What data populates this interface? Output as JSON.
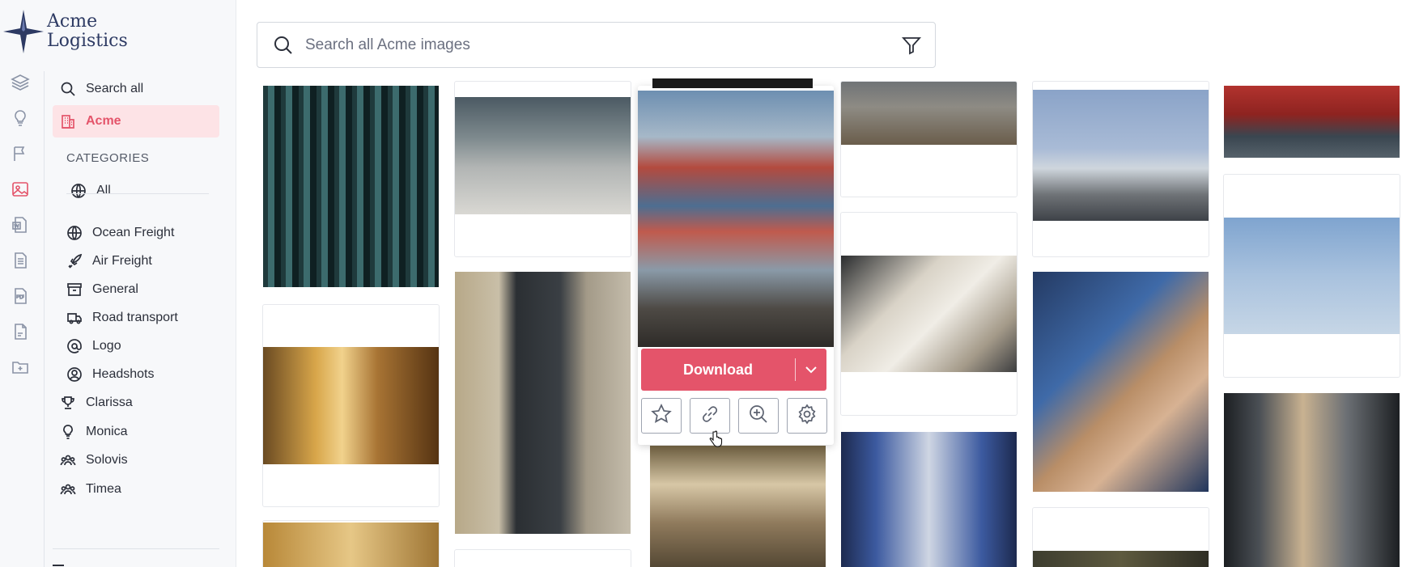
{
  "brand": {
    "line1": "Acme",
    "line2": "Logistics",
    "color": "#2d3a63"
  },
  "rail": [
    {
      "icon": "layers-icon"
    },
    {
      "icon": "bulb-icon"
    },
    {
      "icon": "flag-icon"
    },
    {
      "icon": "image-icon",
      "active": true
    },
    {
      "icon": "doc-word-icon"
    },
    {
      "icon": "doc-lines-icon"
    },
    {
      "icon": "pdf-icon"
    },
    {
      "icon": "file-icon"
    },
    {
      "icon": "folder-plus-icon"
    }
  ],
  "nav": {
    "search_all": "Search all",
    "acme": "Acme",
    "categories_heading": "CATEGORIES",
    "all": "All",
    "ocean_freight": "Ocean Freight",
    "air_freight": "Air Freight",
    "general": "General",
    "road_transport": "Road transport",
    "logo": "Logo",
    "headshots": "Headshots",
    "clarissa": "Clarissa",
    "monica": "Monica",
    "solovis": "Solovis",
    "timea": "Timea"
  },
  "search": {
    "placeholder": "Search all Acme images"
  },
  "hover": {
    "download_label": "Download"
  },
  "colors": {
    "accent": "#e4546a",
    "active_bg": "#fde3e6"
  }
}
